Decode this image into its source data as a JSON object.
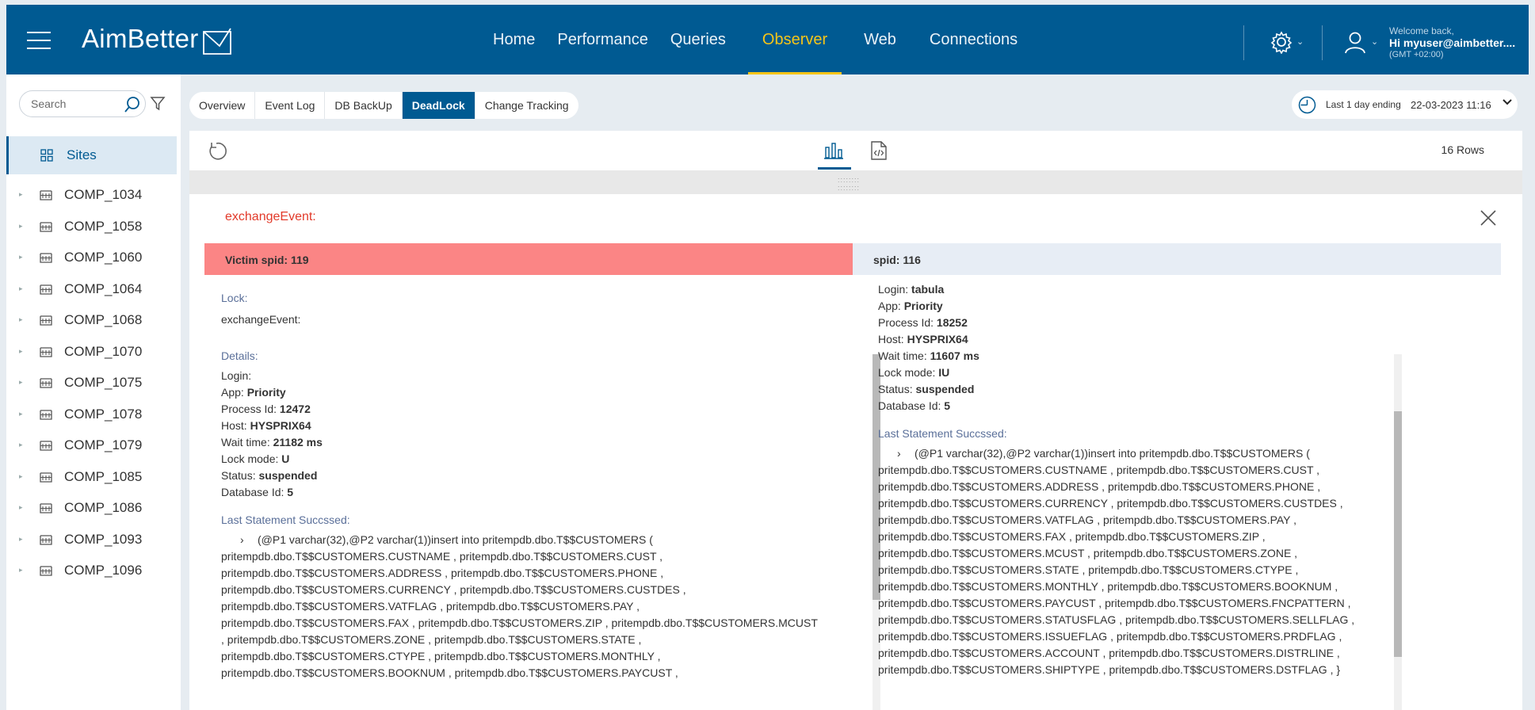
{
  "header": {
    "logo_text": "AimBetter",
    "nav": [
      {
        "label": "Home",
        "active": false
      },
      {
        "label": "Performance",
        "active": false
      },
      {
        "label": "Queries",
        "active": false
      },
      {
        "label": "Observer",
        "active": true
      },
      {
        "label": "Web",
        "active": false
      },
      {
        "label": "Connections",
        "active": false
      }
    ],
    "welcome_line1": "Welcome back,",
    "welcome_line2": "Hi myuser@aimbetter....",
    "welcome_line3": "(GMT +02:00)",
    "icons": [
      "menu-icon",
      "gear-icon",
      "user-icon"
    ],
    "accent_color": "#f5c518",
    "bar_color": "#005a92"
  },
  "sidebar": {
    "search_placeholder": "Search",
    "sites_label": "Sites",
    "items": [
      "COMP_1034",
      "COMP_1058",
      "COMP_1060",
      "COMP_1064",
      "COMP_1068",
      "COMP_1070",
      "COMP_1075",
      "COMP_1078",
      "COMP_1079",
      "COMP_1085",
      "COMP_1086",
      "COMP_1093",
      "COMP_1096"
    ]
  },
  "tabs": [
    {
      "label": "Overview",
      "active": false
    },
    {
      "label": "Event Log",
      "active": false
    },
    {
      "label": "DB BackUp",
      "active": false
    },
    {
      "label": "DeadLock",
      "active": true
    },
    {
      "label": "Change Tracking",
      "active": false
    }
  ],
  "time_range": {
    "label": "Last 1 day ending",
    "value": "22-03-2023 11:16"
  },
  "toolbar": {
    "rows_label": "16 Rows"
  },
  "detail": {
    "event_title": "exchangeEvent:",
    "victim": {
      "header": "Victim spid: 119",
      "lock_label": "Lock:",
      "lock_value": "exchangeEvent:",
      "details_label": "Details:",
      "fields": [
        {
          "k": "Login:",
          "v": ""
        },
        {
          "k": "App:",
          "v": "Priority"
        },
        {
          "k": "Process Id:",
          "v": "12472"
        },
        {
          "k": "Host:",
          "v": "HYSPRIX64"
        },
        {
          "k": "Wait time:",
          "v": "21182 ms"
        },
        {
          "k": "Lock mode:",
          "v": "U"
        },
        {
          "k": "Status:",
          "v": "suspended"
        },
        {
          "k": "Database Id:",
          "v": "5"
        }
      ],
      "statement_label": "Last Statement Succssed:",
      "statement_lines": [
        "(@P1 varchar(32),@P2 varchar(1))insert into pritempdb.dbo.T$$CUSTOMERS (",
        "pritempdb.dbo.T$$CUSTOMERS.CUSTNAME , pritempdb.dbo.T$$CUSTOMERS.CUST ,",
        "pritempdb.dbo.T$$CUSTOMERS.ADDRESS , pritempdb.dbo.T$$CUSTOMERS.PHONE ,",
        "pritempdb.dbo.T$$CUSTOMERS.CURRENCY , pritempdb.dbo.T$$CUSTOMERS.CUSTDES ,",
        "pritempdb.dbo.T$$CUSTOMERS.VATFLAG , pritempdb.dbo.T$$CUSTOMERS.PAY ,",
        "pritempdb.dbo.T$$CUSTOMERS.FAX , pritempdb.dbo.T$$CUSTOMERS.ZIP , pritempdb.dbo.T$$CUSTOMERS.MCUST",
        ", pritempdb.dbo.T$$CUSTOMERS.ZONE , pritempdb.dbo.T$$CUSTOMERS.STATE ,",
        "pritempdb.dbo.T$$CUSTOMERS.CTYPE , pritempdb.dbo.T$$CUSTOMERS.MONTHLY ,",
        "pritempdb.dbo.T$$CUSTOMERS.BOOKNUM , pritempdb.dbo.T$$CUSTOMERS.PAYCUST ,"
      ]
    },
    "other": {
      "header": "spid: 116",
      "fields": [
        {
          "k": "Login:",
          "v": "tabula"
        },
        {
          "k": "App:",
          "v": "Priority"
        },
        {
          "k": "Process Id:",
          "v": "18252"
        },
        {
          "k": "Host:",
          "v": "HYSPRIX64"
        },
        {
          "k": "Wait time:",
          "v": "11607 ms"
        },
        {
          "k": "Lock mode:",
          "v": "IU"
        },
        {
          "k": "Status:",
          "v": "suspended"
        },
        {
          "k": "Database Id:",
          "v": "5"
        }
      ],
      "statement_label": "Last Statement Succssed:",
      "statement_lines": [
        "(@P1 varchar(32),@P2 varchar(1))insert into pritempdb.dbo.T$$CUSTOMERS (",
        "pritempdb.dbo.T$$CUSTOMERS.CUSTNAME , pritempdb.dbo.T$$CUSTOMERS.CUST ,",
        "pritempdb.dbo.T$$CUSTOMERS.ADDRESS , pritempdb.dbo.T$$CUSTOMERS.PHONE ,",
        "pritempdb.dbo.T$$CUSTOMERS.CURRENCY , pritempdb.dbo.T$$CUSTOMERS.CUSTDES ,",
        "pritempdb.dbo.T$$CUSTOMERS.VATFLAG , pritempdb.dbo.T$$CUSTOMERS.PAY ,",
        "pritempdb.dbo.T$$CUSTOMERS.FAX , pritempdb.dbo.T$$CUSTOMERS.ZIP ,",
        "pritempdb.dbo.T$$CUSTOMERS.MCUST , pritempdb.dbo.T$$CUSTOMERS.ZONE ,",
        "pritempdb.dbo.T$$CUSTOMERS.STATE , pritempdb.dbo.T$$CUSTOMERS.CTYPE ,",
        "pritempdb.dbo.T$$CUSTOMERS.MONTHLY , pritempdb.dbo.T$$CUSTOMERS.BOOKNUM ,",
        "pritempdb.dbo.T$$CUSTOMERS.PAYCUST , pritempdb.dbo.T$$CUSTOMERS.FNCPATTERN ,",
        "pritempdb.dbo.T$$CUSTOMERS.STATUSFLAG , pritempdb.dbo.T$$CUSTOMERS.SELLFLAG ,",
        "pritempdb.dbo.T$$CUSTOMERS.ISSUEFLAG , pritempdb.dbo.T$$CUSTOMERS.PRDFLAG ,",
        "pritempdb.dbo.T$$CUSTOMERS.ACCOUNT , pritempdb.dbo.T$$CUSTOMERS.DISTRLINE ,",
        "pritempdb.dbo.T$$CUSTOMERS.SHIPTYPE , pritempdb.dbo.T$$CUSTOMERS.DSTFLAG , }"
      ]
    },
    "victim_color": "#fb8585",
    "title_color": "#e23a2a"
  }
}
